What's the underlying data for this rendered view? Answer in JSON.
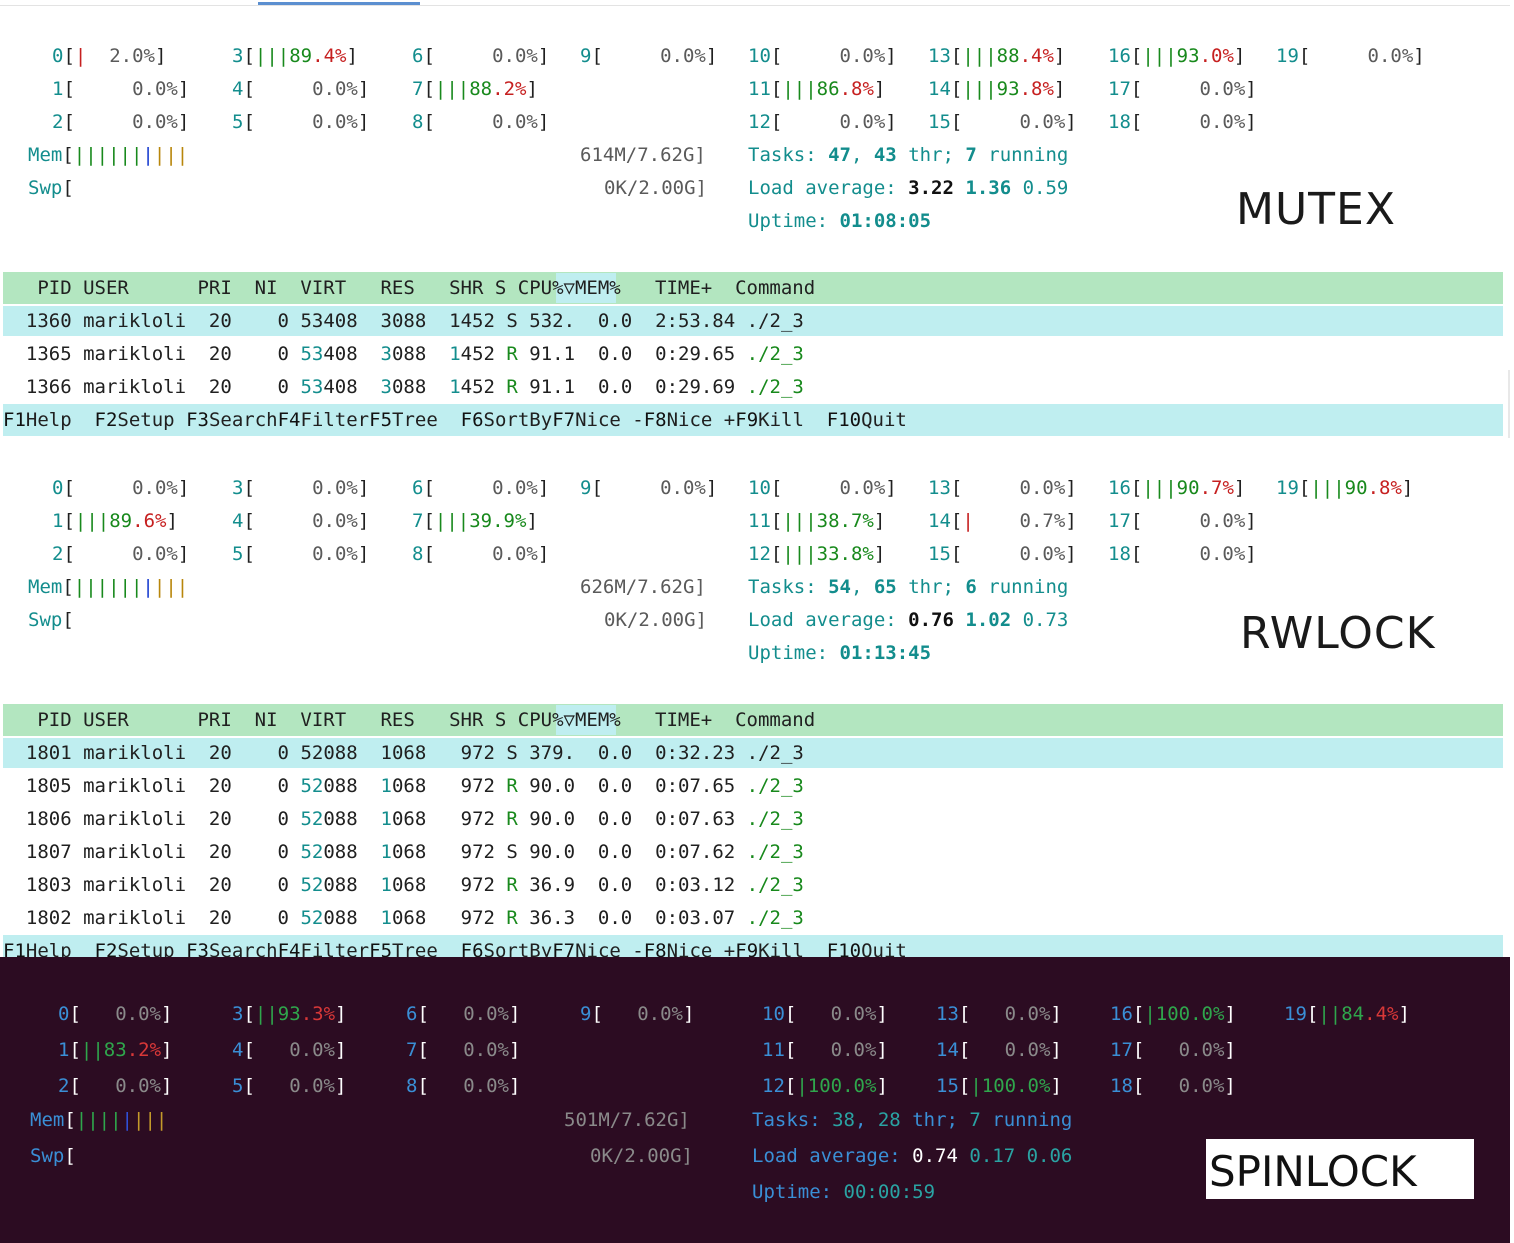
{
  "mutex": {
    "label": "MUTEX",
    "cpus": [
      [
        "0[",
        "|",
        "  2.0%]"
      ],
      [
        "1[",
        "",
        "     0.0%]"
      ],
      [
        "2[",
        "",
        "     0.0%]"
      ],
      [
        "3[",
        "|||",
        "89.4%]"
      ],
      [
        "4[",
        "",
        "     0.0%]"
      ],
      [
        "5[",
        "",
        "     0.0%]"
      ],
      [
        "6[",
        "",
        "     0.0%]"
      ],
      [
        "7[",
        "|||",
        "88.2%]"
      ],
      [
        "8[",
        "",
        "     0.0%]"
      ],
      [
        "9[",
        "",
        "     0.0%]"
      ],
      [
        "10[",
        "",
        "     0.0%]"
      ],
      [
        "11[",
        "|||",
        "86.8%]"
      ],
      [
        "12[",
        "",
        "     0.0%]"
      ],
      [
        "13[",
        "|||",
        "88.4%]"
      ],
      [
        "14[",
        "|||",
        "93.8%]"
      ],
      [
        "15[",
        "",
        "     0.0%]"
      ],
      [
        "16[",
        "|||",
        "93.0%]"
      ],
      [
        "17[",
        "",
        "     0.0%]"
      ],
      [
        "18[",
        "",
        "     0.0%]"
      ],
      [
        "19[",
        "",
        "     0.0%]"
      ]
    ],
    "mem": "614M/7.62G]",
    "swp": "0K/2.00G]",
    "tasks": [
      "Tasks: ",
      "47",
      ", ",
      "43",
      " thr; ",
      "7",
      " running"
    ],
    "load": [
      "Load average: ",
      "3.22",
      "1.36",
      "0.59"
    ],
    "uptime": [
      "Uptime: ",
      "01:08:05"
    ],
    "header": "  PID USER      PRI  NI  VIRT   RES   SHR S ",
    "header_cpu": "CPU%▽",
    "header_rest": "MEM%   TIME+  Command",
    "rows": [
      [
        "1360",
        "marikloli",
        "20",
        "0",
        "53408",
        "3088",
        "1452",
        "S",
        "532.",
        "0.0",
        "2:53.84",
        "./2_3"
      ],
      [
        "1365",
        "marikloli",
        "20",
        "0",
        "53408",
        "3088",
        "1452",
        "R",
        "91.1",
        "0.0",
        "0:29.65",
        "./2_3"
      ],
      [
        "1366",
        "marikloli",
        "20",
        "0",
        "53408",
        "3088",
        "1452",
        "R",
        "91.1",
        "0.0",
        "0:29.69",
        "./2_3"
      ]
    ],
    "fkeys": [
      [
        "F1",
        "Help  "
      ],
      [
        "F2",
        "Setup "
      ],
      [
        "F3",
        "Search"
      ],
      [
        "F4",
        "Filter"
      ],
      [
        "F5",
        "Tree  "
      ],
      [
        "F6",
        "SortBy"
      ],
      [
        "F7",
        "Nice -"
      ],
      [
        "F8",
        "Nice +"
      ],
      [
        "F9",
        "Kill  "
      ],
      [
        "F10",
        "Quit"
      ]
    ]
  },
  "rwlock": {
    "label": "RWLOCK",
    "cpus": [
      [
        "0[",
        "",
        "     0.0%]"
      ],
      [
        "1[",
        "|||",
        "89.6%]"
      ],
      [
        "2[",
        "",
        "     0.0%]"
      ],
      [
        "3[",
        "",
        "     0.0%]"
      ],
      [
        "4[",
        "",
        "     0.0%]"
      ],
      [
        "5[",
        "",
        "     0.0%]"
      ],
      [
        "6[",
        "",
        "     0.0%]"
      ],
      [
        "7[",
        "|||",
        "39.9%]"
      ],
      [
        "8[",
        "",
        "     0.0%]"
      ],
      [
        "9[",
        "",
        "     0.0%]"
      ],
      [
        "10[",
        "",
        "     0.0%]"
      ],
      [
        "11[",
        "|||",
        "38.7%]"
      ],
      [
        "12[",
        "|||",
        "33.8%]"
      ],
      [
        "13[",
        "",
        "     0.0%]"
      ],
      [
        "14[",
        "|",
        "    0.7%]"
      ],
      [
        "15[",
        "",
        "     0.0%]"
      ],
      [
        "16[",
        "|||",
        "90.7%]"
      ],
      [
        "17[",
        "",
        "     0.0%]"
      ],
      [
        "18[",
        "",
        "     0.0%]"
      ],
      [
        "19[",
        "|||",
        "90.8%]"
      ]
    ],
    "mem": "626M/7.62G]",
    "swp": "0K/2.00G]",
    "tasks": [
      "Tasks: ",
      "54",
      ", ",
      "65",
      " thr; ",
      "6",
      " running"
    ],
    "load": [
      "Load average: ",
      "0.76",
      "1.02",
      "0.73"
    ],
    "uptime": [
      "Uptime: ",
      "01:13:45"
    ],
    "header": "  PID USER      PRI  NI  VIRT   RES   SHR S ",
    "header_cpu": "CPU%▽",
    "header_rest": "MEM%   TIME+  Command",
    "rows": [
      [
        "1801",
        "marikloli",
        "20",
        "0",
        "52088",
        "1068",
        "972",
        "S",
        "379.",
        "0.0",
        "0:32.23",
        "./2_3"
      ],
      [
        "1805",
        "marikloli",
        "20",
        "0",
        "52088",
        "1068",
        "972",
        "R",
        "90.0",
        "0.0",
        "0:07.65",
        "./2_3"
      ],
      [
        "1806",
        "marikloli",
        "20",
        "0",
        "52088",
        "1068",
        "972",
        "R",
        "90.0",
        "0.0",
        "0:07.63",
        "./2_3"
      ],
      [
        "1807",
        "marikloli",
        "20",
        "0",
        "52088",
        "1068",
        "972",
        "S",
        "90.0",
        "0.0",
        "0:07.62",
        "./2_3"
      ],
      [
        "1803",
        "marikloli",
        "20",
        "0",
        "52088",
        "1068",
        "972",
        "R",
        "36.9",
        "0.0",
        "0:03.12",
        "./2_3"
      ],
      [
        "1802",
        "marikloli",
        "20",
        "0",
        "52088",
        "1068",
        "972",
        "R",
        "36.3",
        "0.0",
        "0:03.07",
        "./2_3"
      ]
    ],
    "fkeys": [
      [
        "F1",
        "Help  "
      ],
      [
        "F2",
        "Setup "
      ],
      [
        "F3",
        "Search"
      ],
      [
        "F4",
        "Filter"
      ],
      [
        "F5",
        "Tree  "
      ],
      [
        "F6",
        "SortBy"
      ],
      [
        "F7",
        "Nice -"
      ],
      [
        "F8",
        "Nice +"
      ],
      [
        "F9",
        "Kill  "
      ],
      [
        "F10",
        "Quit"
      ]
    ]
  },
  "spinlock": {
    "label": "SPINLOCK",
    "cpus": [
      [
        "0[",
        "",
        "   0.0%]"
      ],
      [
        "1[",
        "||",
        "83.2%]"
      ],
      [
        "2[",
        "",
        "   0.0%]"
      ],
      [
        "3[",
        "||",
        "93.3%]"
      ],
      [
        "4[",
        "",
        "   0.0%]"
      ],
      [
        "5[",
        "",
        "   0.0%]"
      ],
      [
        "6[",
        "",
        "   0.0%]"
      ],
      [
        "7[",
        "",
        "   0.0%]"
      ],
      [
        "8[",
        "",
        "   0.0%]"
      ],
      [
        "9[",
        "",
        "   0.0%]"
      ],
      [
        "10[",
        "",
        "   0.0%]"
      ],
      [
        "11[",
        "",
        "   0.0%]"
      ],
      [
        "12[",
        "|",
        "100.0%]"
      ],
      [
        "13[",
        "",
        "   0.0%]"
      ],
      [
        "14[",
        "",
        "   0.0%]"
      ],
      [
        "15[",
        "|",
        "100.0%]"
      ],
      [
        "16[",
        "|",
        "100.0%]"
      ],
      [
        "17[",
        "",
        "   0.0%]"
      ],
      [
        "18[",
        "",
        "   0.0%]"
      ],
      [
        "19[",
        "||",
        "84.4%]"
      ]
    ],
    "mem": "501M/7.62G]",
    "swp": "0K/2.00G]",
    "tasks": [
      "Tasks: ",
      "38",
      ", ",
      "28",
      " thr; ",
      "7",
      " running"
    ],
    "load": [
      "Load average: ",
      "0.74",
      "0.17",
      "0.06"
    ],
    "uptime": [
      "Uptime: ",
      "00:00:59"
    ]
  }
}
